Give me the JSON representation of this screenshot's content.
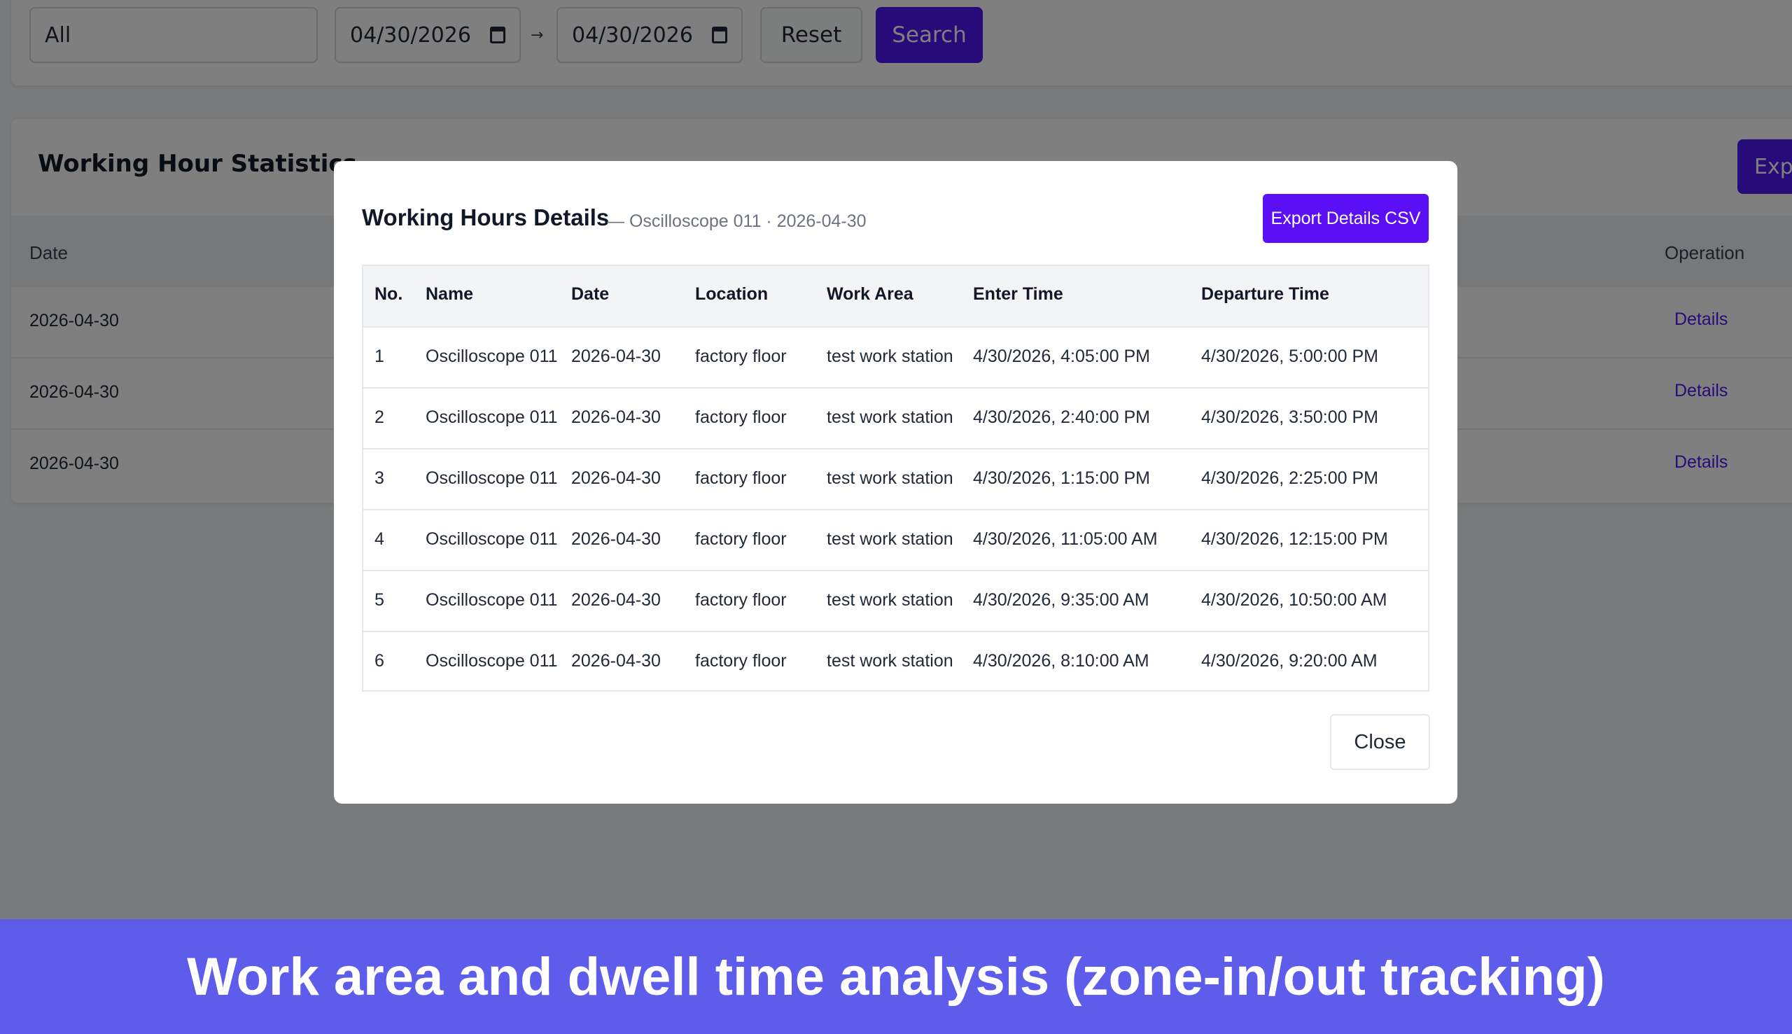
{
  "filters": {
    "select_value": "All",
    "date_from": "04/30/2026",
    "range_separator": "→",
    "date_to": "04/30/2026",
    "reset_label": "Reset",
    "search_label": "Search"
  },
  "stats": {
    "title": "Working Hour Statistics",
    "export_label": "Expo",
    "columns": {
      "date": "Date",
      "operation": "Operation"
    },
    "rows": [
      {
        "date": "2026-04-30",
        "action": "Details"
      },
      {
        "date": "2026-04-30",
        "action": "Details"
      },
      {
        "date": "2026-04-30",
        "action": "Details"
      }
    ]
  },
  "modal": {
    "title": "Working Hours Details",
    "subtitle": "— Oscilloscope 011 · 2026-04-30",
    "export_label": "Export Details CSV",
    "columns": [
      "No.",
      "Name",
      "Date",
      "Location",
      "Work Area",
      "Enter Time",
      "Departure Time"
    ],
    "rows": [
      [
        "1",
        "Oscilloscope 011",
        "2026-04-30",
        "factory floor",
        "test work station",
        "4/30/2026, 4:05:00 PM",
        "4/30/2026, 5:00:00 PM"
      ],
      [
        "2",
        "Oscilloscope 011",
        "2026-04-30",
        "factory floor",
        "test work station",
        "4/30/2026, 2:40:00 PM",
        "4/30/2026, 3:50:00 PM"
      ],
      [
        "3",
        "Oscilloscope 011",
        "2026-04-30",
        "factory floor",
        "test work station",
        "4/30/2026, 1:15:00 PM",
        "4/30/2026, 2:25:00 PM"
      ],
      [
        "4",
        "Oscilloscope 011",
        "2026-04-30",
        "factory floor",
        "test work station",
        "4/30/2026, 11:05:00 AM",
        "4/30/2026, 12:15:00 PM"
      ],
      [
        "5",
        "Oscilloscope 011",
        "2026-04-30",
        "factory floor",
        "test work station",
        "4/30/2026, 9:35:00 AM",
        "4/30/2026, 10:50:00 AM"
      ],
      [
        "6",
        "Oscilloscope 011",
        "2026-04-30",
        "factory floor",
        "test work station",
        "4/30/2026, 8:10:00 AM",
        "4/30/2026, 9:20:00 AM"
      ]
    ],
    "close_label": "Close"
  },
  "caption": "Work area and dwell time analysis (zone-in/out tracking)",
  "colors": {
    "accent": "#4f17f3",
    "export_button": "#5b0ff5",
    "banner": "#5e5ceb"
  }
}
